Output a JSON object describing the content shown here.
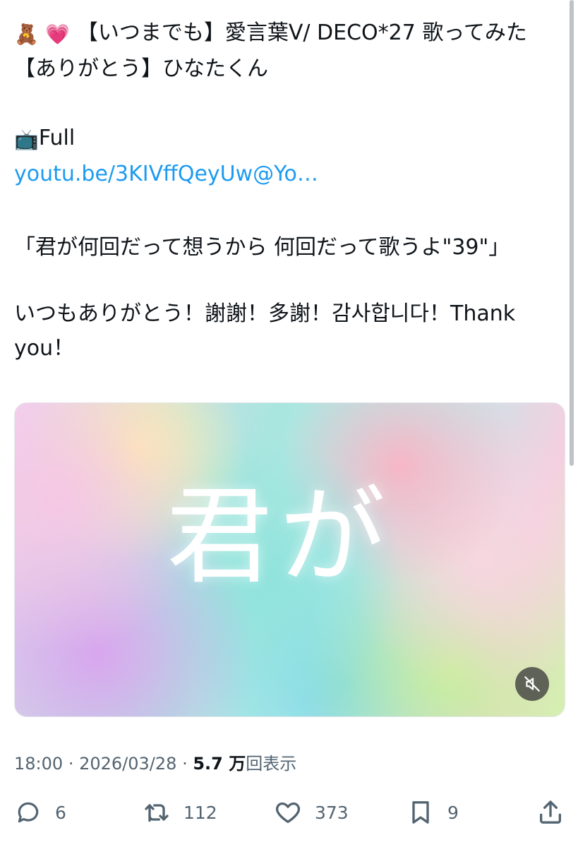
{
  "tweet": {
    "title_line1": "【いつまでも】愛言葉V/ DECO*27 歌ってみた",
    "title_line2": "【ありがとう】ひなたくん",
    "full_label": "Full",
    "link_text": "youtu.be/3KIVffQeyUw@Yo…",
    "quote": "「君が何回だって想うから 何回だって歌うよ\"39\"」",
    "thanks_line1": "いつもありがとう！謝謝！多謝！감사합니다！Thank",
    "thanks_line2": "you！"
  },
  "emoji": {
    "bear": "🧸",
    "heart": "💗",
    "tv": "📺"
  },
  "media": {
    "caption": "君が"
  },
  "meta": {
    "time": "18:00",
    "separator": "·",
    "date": "2026/03/28",
    "views_count": "5.7 万",
    "views_label": "回表示"
  },
  "actions": {
    "replies": "6",
    "retweets": "112",
    "likes": "373",
    "bookmarks": "9"
  },
  "colors": {
    "link": "#1d9bf0",
    "text": "#0f1419",
    "secondary": "#536471"
  }
}
